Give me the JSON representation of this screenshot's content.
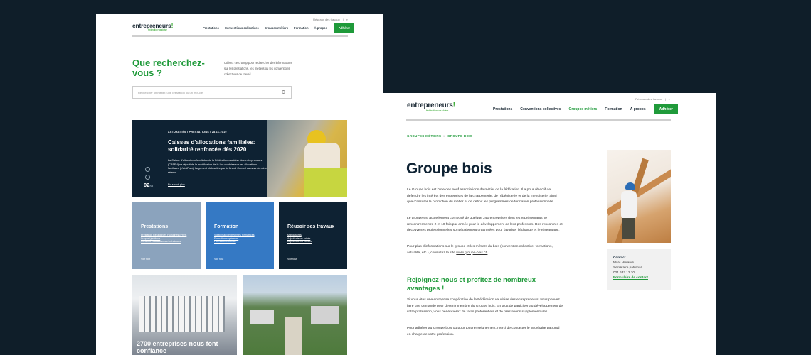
{
  "left_page": {
    "topbar": {
      "label": "Réseaux des travaux",
      "sep": "|",
      "search_icon": "search-icon"
    },
    "logo": {
      "name": "entrepreneurs",
      "mark": "!",
      "sub": "fédération vaudoise"
    },
    "nav": [
      "Prestations",
      "Conventions collectives",
      "Groupes métiers",
      "Formation",
      "À propos"
    ],
    "cta": "Adhérer",
    "search": {
      "title": "Que recherchez-vous ?",
      "description": "Utilisez ce champ pour rechercher des informations sur les prestations, les métiers ou les conventions collectives de travail.",
      "placeholder": "Rechercher un métier, une prestation ou un mot-clé"
    },
    "hero": {
      "kicker": "ACTUALITÉS | PRESTATIONS | 28.11.2019",
      "title": "Caisses d'allocations familiales: solidarité renforcée dès 2020",
      "text": "La Caisse d'allocations familiales de la Fédération vaudoise des entrepreneurs (CAFEV) se réjouit de la modification de la Loi vaudoise sur les allocations familiales (LVLAFam), largement plébiscitée par le Grand Conseil dans sa dernière séance.",
      "link": "En savoir plus",
      "counter": "02",
      "counter_total": "/03"
    },
    "tiles": [
      {
        "title": "Prestations",
        "links": [
          "Prestation Ressources Humaines (PRH)",
          "Support juridique",
          "Conseils et assistances techniques"
        ],
        "more": "Voir tout"
      },
      {
        "title": "Formation",
        "links": [
          "Soutien aux entreprises formatrices",
          "Formation supérieure",
          "Formation continue"
        ],
        "more": "Voir tout"
      },
      {
        "title": "Réussir ses travaux",
        "links": [
          "Mandataires",
          "Adjudicateurs privés",
          "Adjudicateurs publics"
        ],
        "more": "Voir tout"
      }
    ],
    "feature_caption": "2700 entreprises nous font confiance"
  },
  "right_page": {
    "topbar": {
      "label": "Réseaux des travaux",
      "sep": "|",
      "search_icon": "search-icon"
    },
    "logo": {
      "name": "entrepreneurs",
      "mark": "!",
      "sub": "fédération vaudoise"
    },
    "nav": [
      "Prestations",
      "Conventions collectives",
      "Groupes métiers",
      "Formation",
      "À propos"
    ],
    "nav_active_index": 2,
    "cta": "Adhérer",
    "breadcrumb": [
      "GROUPES MÉTIERS",
      "GROUPE BOIS"
    ],
    "breadcrumb_sep": "»",
    "title": "Groupe bois",
    "p1": "Le Groupe bois est l'une des neuf associations de métier de la fédération. Il a pour objectif de défendre les intérêts des entreprises de la charpenterie, de l'ébénisterie et de la menuiserie, ainsi que d'assurer la promotion du métier et de définir les programmes de formation professionnelle.",
    "p2": "Le groupe est actuellement composé de quelque 240 entreprises dont les représentants se rencontrent entre 2 et 10 fois par année pour le développement de leur profession. Des rencontres et découvertes professionnelles sont également organisées pour favoriser l'échange et le réseautage.",
    "p3_text": "Pour plus d'informations sur le groupe et les métiers du bois (convention collective, formations, actualité, etc.), consultez le site ",
    "p3_link": "www.groupe-bois.ch",
    "p3_end": ".",
    "h2": "Rejoignez-nous et profitez de nombreux avantages !",
    "p4": "Si vous êtes une entreprise coopérative de la Fédération vaudoise des entrepreneurs, vous pouvez faire une demande pour devenir membre du Groupe bois. En plus de participer au développement de votre profession, vous bénéficierez de tarifs préférentiels et de prestations supplémentaires.",
    "p5": "Pour adhérer au Groupe bois ou pour tout renseignement, merci de contacter le secrétaire patronal en charge de votre profession.",
    "contact": {
      "label": "Contact",
      "name": "Marc Morandi",
      "role": "Secrétaire patronal",
      "phone": "021 632 12 10",
      "link": "Formulaire de contact"
    }
  },
  "colors": {
    "green": "#1f9a3a",
    "navy": "#0e2233",
    "blue": "#3579c4",
    "slate": "#8ba3bd",
    "background": "#0f1e29"
  }
}
